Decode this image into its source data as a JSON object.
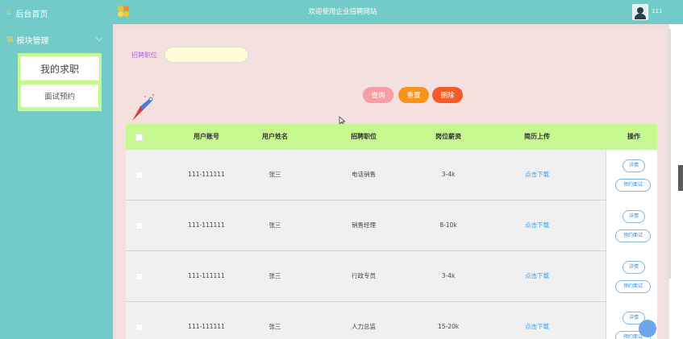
{
  "topbar": {
    "home_label": "后台首页",
    "site_title": "欢迎使用企业招聘网站",
    "username": "111"
  },
  "sidebar": {
    "module_label": "模块管理",
    "items": [
      {
        "label": "我的求职"
      },
      {
        "label": "面试预约"
      }
    ]
  },
  "search": {
    "label": "招聘职位",
    "value": "",
    "buttons": {
      "query": "查询",
      "reset": "重置",
      "delete": "删除"
    }
  },
  "table": {
    "headers": [
      "用户账号",
      "用户姓名",
      "招聘职位",
      "岗位薪资",
      "简历上传",
      "操作"
    ],
    "rows": [
      {
        "account": "111-111111",
        "name": "张三",
        "position": "电话销售",
        "salary": "3-4k",
        "resume": "点击下载",
        "detail": "详情",
        "book": "预约面试"
      },
      {
        "account": "111-111111",
        "name": "张三",
        "position": "销售经理",
        "salary": "8-10k",
        "resume": "点击下载",
        "detail": "详情",
        "book": "预约面试"
      },
      {
        "account": "111-111111",
        "name": "张三",
        "position": "行政专员",
        "salary": "3-4k",
        "resume": "点击下载",
        "detail": "详情",
        "book": "预约面试"
      },
      {
        "account": "111-111111",
        "name": "张三",
        "position": "人力总监",
        "salary": "15-20k",
        "resume": "点击下载",
        "detail": "详情",
        "book": "预约面试"
      }
    ]
  },
  "colors": {
    "brand": "#72cbc8",
    "menu_accent": "#c6fa91",
    "query_button": "#f79ea5",
    "reset_button": "#f7941d",
    "delete_button": "#f45b26",
    "link": "#3ba2f0"
  }
}
